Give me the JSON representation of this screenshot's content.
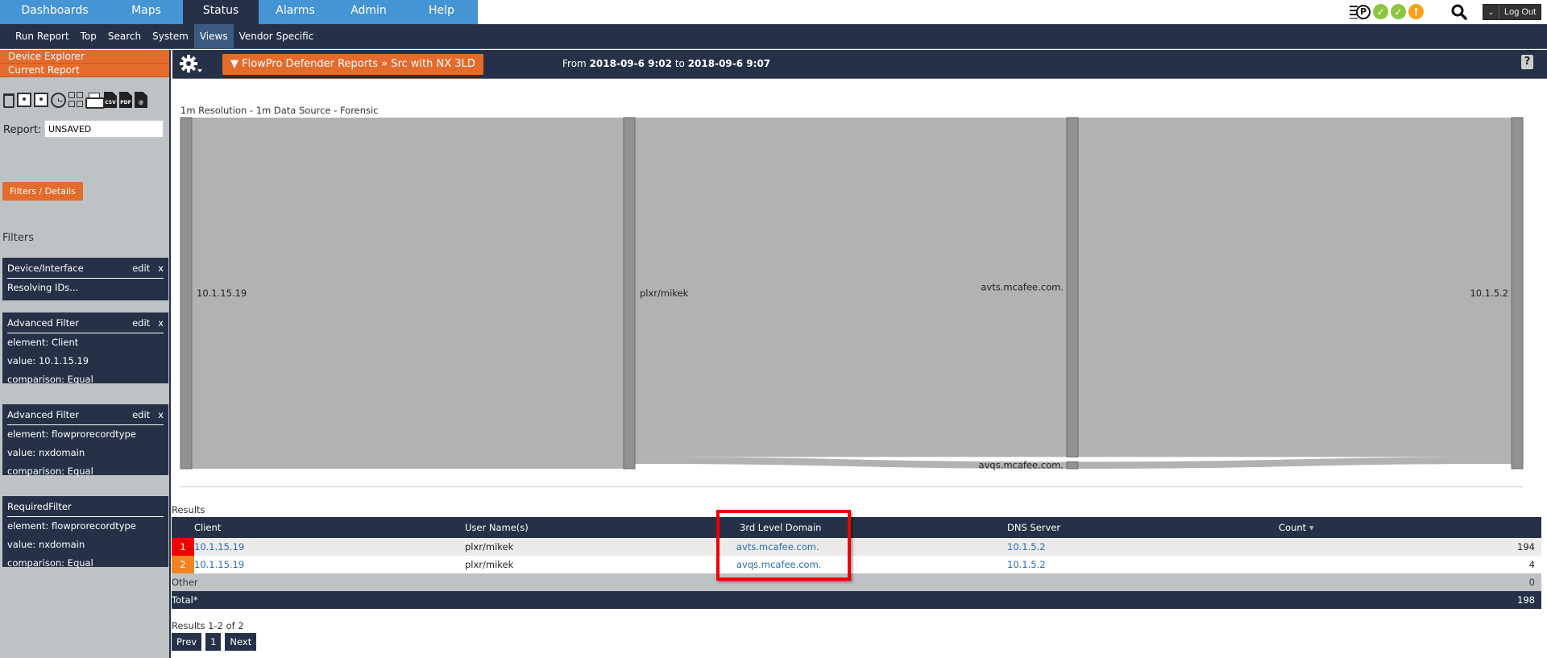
{
  "main_nav": {
    "tabs": [
      {
        "label": "Dashboards",
        "active": false
      },
      {
        "label": "Maps",
        "active": false
      },
      {
        "label": "Status",
        "active": true
      },
      {
        "label": "Alarms",
        "active": false
      },
      {
        "label": "Admin",
        "active": false
      },
      {
        "label": "Help",
        "active": false
      }
    ]
  },
  "status_icons": {
    "poller_label": "P",
    "check_glyph": "✓",
    "warn_glyph": "!"
  },
  "header": {
    "logout_label": "Log Out",
    "logout_caret": "⌄"
  },
  "sub_nav": {
    "tabs": [
      {
        "label": "Run Report",
        "active": false
      },
      {
        "label": "Top",
        "active": false
      },
      {
        "label": "Search",
        "active": false
      },
      {
        "label": "System",
        "active": false
      },
      {
        "label": "Views",
        "active": true
      },
      {
        "label": "Vendor Specific",
        "active": false
      }
    ]
  },
  "sidebar": {
    "device_explorer": "Device Explorer",
    "current_report": "Current Report",
    "tool_icons": [
      "trash-icon",
      "save-icon",
      "save-as-icon",
      "schedule-clock-icon",
      "layout-grid-icon",
      "print-icon",
      "csv-export-icon",
      "pdf-export-icon",
      "email-export-icon"
    ],
    "csv_label": "CSV",
    "pdf_label": "PDF",
    "email_label": "@",
    "report_label": "Report:",
    "report_value": "UNSAVED",
    "filters_details_button": "Filters / Details",
    "filters_heading": "Filters",
    "filter_cards": [
      {
        "title": "Device/Interface",
        "edit": "edit",
        "remove": "x",
        "lines": [
          "Resolving IDs..."
        ]
      },
      {
        "title": "Advanced Filter",
        "edit": "edit",
        "remove": "x",
        "lines": [
          "element: Client",
          "value: 10.1.15.19",
          "comparison: Equal"
        ]
      },
      {
        "title": "Advanced Filter",
        "edit": "edit",
        "remove": "x",
        "lines": [
          "element: flowprorecordtype",
          "value: nxdomain",
          "comparison: Equal"
        ]
      },
      {
        "title": "RequiredFilter",
        "lines": [
          "element: flowprorecordtype",
          "value: nxdomain",
          "comparison: Equal"
        ]
      }
    ]
  },
  "report_bar": {
    "title": "▼ FlowPro Defender Reports » Src with NX 3LD",
    "from_label": "From",
    "from_value": "2018-09-6 9:02",
    "to_label": "to",
    "to_value": "2018-09-6 9:07",
    "help_label": "?"
  },
  "resolution_note": "1m Resolution - 1m Data Source - Forensic",
  "chart_data": {
    "type": "sankey",
    "columns": [
      "Client",
      "User Name(s)",
      "3rd Level Domain",
      "DNS Server"
    ],
    "nodes": [
      {
        "id": "client-10.1.15.19",
        "label": "10.1.15.19",
        "column": 0,
        "value": 198
      },
      {
        "id": "user-plxr/mikek",
        "label": "plxr/mikek",
        "column": 1,
        "value": 198
      },
      {
        "id": "domain-avts",
        "label": "avts.mcafee.com.",
        "column": 2,
        "value": 194
      },
      {
        "id": "domain-avqs",
        "label": "avqs.mcafee.com.",
        "column": 2,
        "value": 4
      },
      {
        "id": "dns-10.1.5.2",
        "label": "10.1.5.2",
        "column": 3,
        "value": 198
      }
    ],
    "links": [
      {
        "source": "client-10.1.15.19",
        "target": "user-plxr/mikek",
        "value": 198
      },
      {
        "source": "user-plxr/mikek",
        "target": "domain-avts",
        "value": 194
      },
      {
        "source": "user-plxr/mikek",
        "target": "domain-avqs",
        "value": 4
      },
      {
        "source": "domain-avts",
        "target": "dns-10.1.5.2",
        "value": 194
      },
      {
        "source": "domain-avqs",
        "target": "dns-10.1.5.2",
        "value": 4
      }
    ]
  },
  "results": {
    "label": "Results",
    "columns": [
      "Client",
      "User Name(s)",
      "3rd Level Domain",
      "DNS Server",
      "Count"
    ],
    "sort_indicator": "▾",
    "rows": [
      {
        "rank": "1",
        "client": "10.1.15.19",
        "user": "plxr/mikek",
        "domain": "avts.mcafee.com.",
        "dns": "10.1.5.2",
        "count": "194"
      },
      {
        "rank": "2",
        "client": "10.1.15.19",
        "user": "plxr/mikek",
        "domain": "avqs.mcafee.com.",
        "dns": "10.1.5.2",
        "count": "4"
      }
    ],
    "other_label": "Other",
    "other_count": "0",
    "total_label": "Total*",
    "total_count": "198",
    "summary": "Results 1-2 of 2",
    "pager": {
      "prev": "Prev",
      "page": "1",
      "next": "Next"
    }
  },
  "colors": {
    "nav_blue": "#4594d3",
    "navy": "#263148",
    "orange": "#e56b2c",
    "rank1": "#ef0000",
    "rank2": "#f58220",
    "link_blue": "#2a6bb0",
    "sankey_flow": "#b2b2b2",
    "sankey_node": "#919191",
    "highlight_red": "#e00000"
  }
}
